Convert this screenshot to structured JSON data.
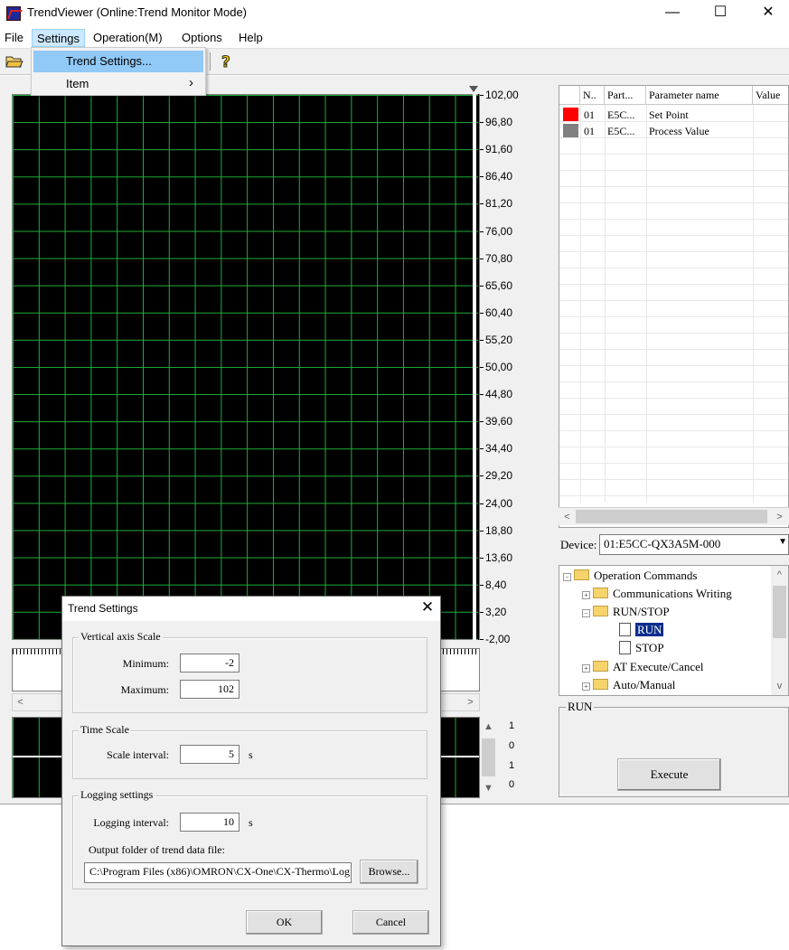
{
  "window": {
    "title": "TrendViewer (Online:Trend Monitor Mode)",
    "minimize": "—",
    "maximize": "☐",
    "close": "✕"
  },
  "menubar": {
    "file": "File",
    "settings": "Settings",
    "operation": "Operation(M)",
    "options": "Options",
    "help": "Help"
  },
  "dropdown": {
    "trend_settings": "Trend Settings...",
    "item": "Item",
    "item_arrow": "›"
  },
  "graph": {
    "y_ticks": [
      "102,00",
      "96,80",
      "91,60",
      "86,40",
      "81,20",
      "76,00",
      "70,80",
      "65,60",
      "60,40",
      "55,20",
      "50,00",
      "44,80",
      "39,60",
      "34,40",
      "29,20",
      "24,00",
      "18,80",
      "13,60",
      "8,40",
      "3,20",
      "-2,00"
    ],
    "small_ticks": [
      "1",
      "0",
      "1",
      "0"
    ]
  },
  "table": {
    "headers": [
      "N..",
      "Part...",
      "Parameter name",
      "Value"
    ],
    "rows": [
      {
        "color": "#ff0000",
        "no": "01",
        "part": "E5C...",
        "name": "Set Point"
      },
      {
        "color": "#808080",
        "no": "01",
        "part": "E5C...",
        "name": "Process Value"
      }
    ]
  },
  "device": {
    "label": "Device:",
    "value": "01:E5CC-QX3A5M-000"
  },
  "tree": {
    "root": "Operation Commands",
    "items": [
      "Communications Writing",
      "RUN/STOP",
      "RUN",
      "STOP",
      "AT Execute/Cancel",
      "Auto/Manual"
    ]
  },
  "run_panel": {
    "label": "RUN",
    "execute": "Execute"
  },
  "dialog": {
    "title": "Trend Settings",
    "close": "✕",
    "vertical_group": "Vertical axis Scale",
    "minimum_label": "Minimum:",
    "minimum_value": "-2",
    "maximum_label": "Maximum:",
    "maximum_value": "102",
    "time_group": "Time Scale",
    "scale_interval_label": "Scale interval:",
    "scale_interval_value": "5",
    "scale_interval_unit": "s",
    "logging_group": "Logging settings",
    "logging_interval_label": "Logging interval:",
    "logging_interval_value": "10",
    "logging_interval_unit": "s",
    "output_folder_label": "Output folder of trend data file:",
    "output_folder_value": "C:\\Program Files (x86)\\OMRON\\CX-One\\CX-Thermo\\Log",
    "browse": "Browse...",
    "ok": "OK",
    "cancel": "Cancel"
  }
}
